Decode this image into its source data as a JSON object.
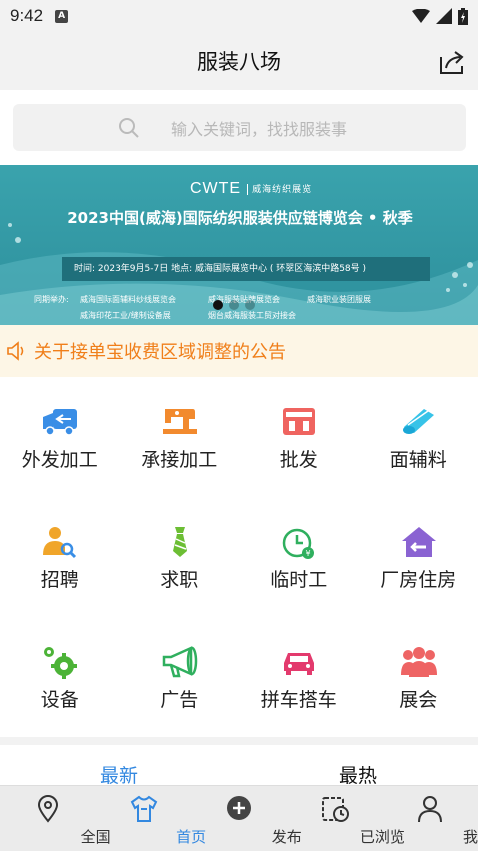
{
  "status": {
    "time": "9:42"
  },
  "header": {
    "title": "服装八场"
  },
  "search": {
    "placeholder": "输入关键词，找找服装事"
  },
  "banner": {
    "logo": "CWTE",
    "logo_cn": "威海纺织展览",
    "headline": "2023中国(威海)国际纺织服装供应链博览会 • 秋季",
    "info": "时间: 2023年9月5-7日  地点: 威海国际展览中心 ( 环翠区海滨中路58号 )",
    "co_label": "同期举办:",
    "co1": "威海国际面辅料纱线展览会",
    "co2": "威海服装贴牌展览会",
    "co3": "威海职业装团服展",
    "co4": "威海印花工业/缝制设备展",
    "co5": "烟台威海服装工贸对接会"
  },
  "notice": {
    "text": "关于接单宝收费区域调整的公告"
  },
  "categories": [
    {
      "label": "外发加工",
      "icon": "truck-icon"
    },
    {
      "label": "承接加工",
      "icon": "sewing-machine-icon"
    },
    {
      "label": "批发",
      "icon": "store-icon"
    },
    {
      "label": "面辅料",
      "icon": "fabric-roll-icon"
    },
    {
      "label": "招聘",
      "icon": "recruiter-icon"
    },
    {
      "label": "求职",
      "icon": "tie-icon"
    },
    {
      "label": "临时工",
      "icon": "clock-icon"
    },
    {
      "label": "厂房住房",
      "icon": "house-icon"
    },
    {
      "label": "设备",
      "icon": "gears-icon"
    },
    {
      "label": "广告",
      "icon": "megaphone-icon"
    },
    {
      "label": "拼车搭车",
      "icon": "car-icon"
    },
    {
      "label": "展会",
      "icon": "people-icon"
    }
  ],
  "feed_tabs": {
    "latest": "最新",
    "hottest": "最热"
  },
  "nav": [
    {
      "label": "全国",
      "icon": "location-icon"
    },
    {
      "label": "首页",
      "icon": "tshirt-icon"
    },
    {
      "label": "发布",
      "icon": "plus-circle-icon"
    },
    {
      "label": "已浏览",
      "icon": "history-icon"
    },
    {
      "label": "我的",
      "icon": "user-icon"
    }
  ],
  "colors": {
    "accent": "#3388e0",
    "notice": "#f07f1a",
    "banner": "#3aa3ad"
  }
}
